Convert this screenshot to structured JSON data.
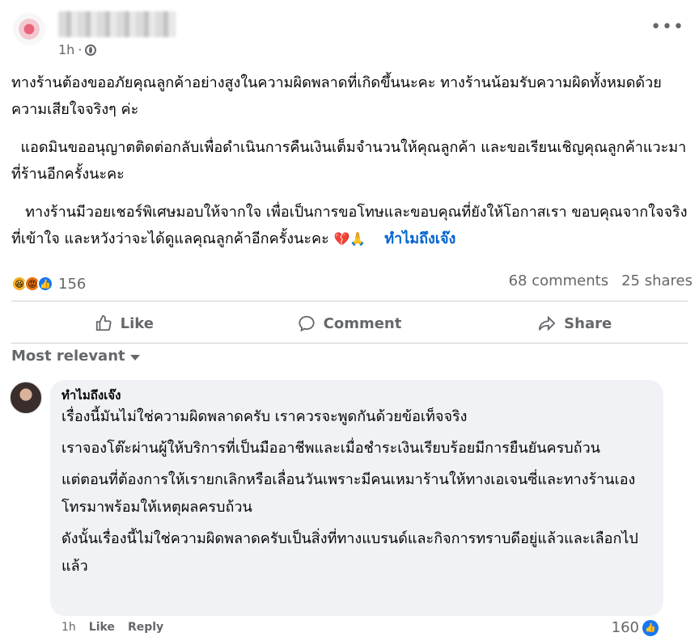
{
  "post": {
    "time": "1h",
    "paragraphs": [
      "ทางร้านต้องขออภัยคุณลูกค้าอย่างสูงในความผิดพลาดที่เกิดขึ้นนะคะ ทางร้านน้อมรับความผิดทั้งหมดด้วยความเสียใจจริงๆ ค่ะ",
      "  แอดมินขออนุญาตติดต่อกลับเพื่อดำเนินการคืนเงินเต็มจำนวนให้คุณลูกค้า และขอเรียนเชิญคุณลูกค้าแวะมาที่ร้านอีกครั้งนะคะ",
      "   ทางร้านมีวอยเชอร์พิเศษมอบให้จากใจ เพื่อเป็นการขอโทษและขอบคุณที่ยังให้โอกาสเรา ขอบคุณจากใจจริงที่เข้าใจ และหวังว่าจะได้ดูแลคุณลูกค้าอีกครั้งนะคะ"
    ],
    "emoji": "💔🙏",
    "mention": "ทำไมถึงเจ๊ง"
  },
  "reactions": {
    "count": "156",
    "comments": "68 comments",
    "shares": "25 shares",
    "icons": [
      "haha",
      "angry",
      "like"
    ]
  },
  "actions": {
    "like": "Like",
    "comment": "Comment",
    "share": "Share"
  },
  "sort": {
    "label": "Most relevant"
  },
  "comment": {
    "author": "ทำไมถึงเจ๊ง",
    "paragraphs": [
      "เรื่องนี้มันไม่ใช่ความผิดพลาดครับ เราควรจะพูดกันด้วยข้อเท็จจริง",
      "เราจองโต๊ะผ่านผู้ให้บริการที่เป็นมืออาชีพและเมื่อชำระเงินเรียบร้อยมีการยืนยันครบถ้วน",
      "แต่ตอนที่ต้องการให้เรายกเลิกหรือเลื่อนวันเพราะมีคนเหมาร้านให้ทางเอเจนซี่และทางร้านเองโทรมาพร้อมให้เหตุผลครบถ้วน",
      "ดังนั้นเรื่องนี้ไม่ใช่ความผิดพลาดครับเป็นสิ่งที่ทางแบรนด์และกิจการทราบดีอยู่แล้วและเลือกไปแล้ว"
    ],
    "time": "1h",
    "like_label": "Like",
    "reply_label": "Reply",
    "like_count": "160"
  },
  "colors": {
    "link": "#0064d1",
    "muted": "#65676b",
    "bubble": "#f0f2f5",
    "like_blue": "#1877f2"
  }
}
